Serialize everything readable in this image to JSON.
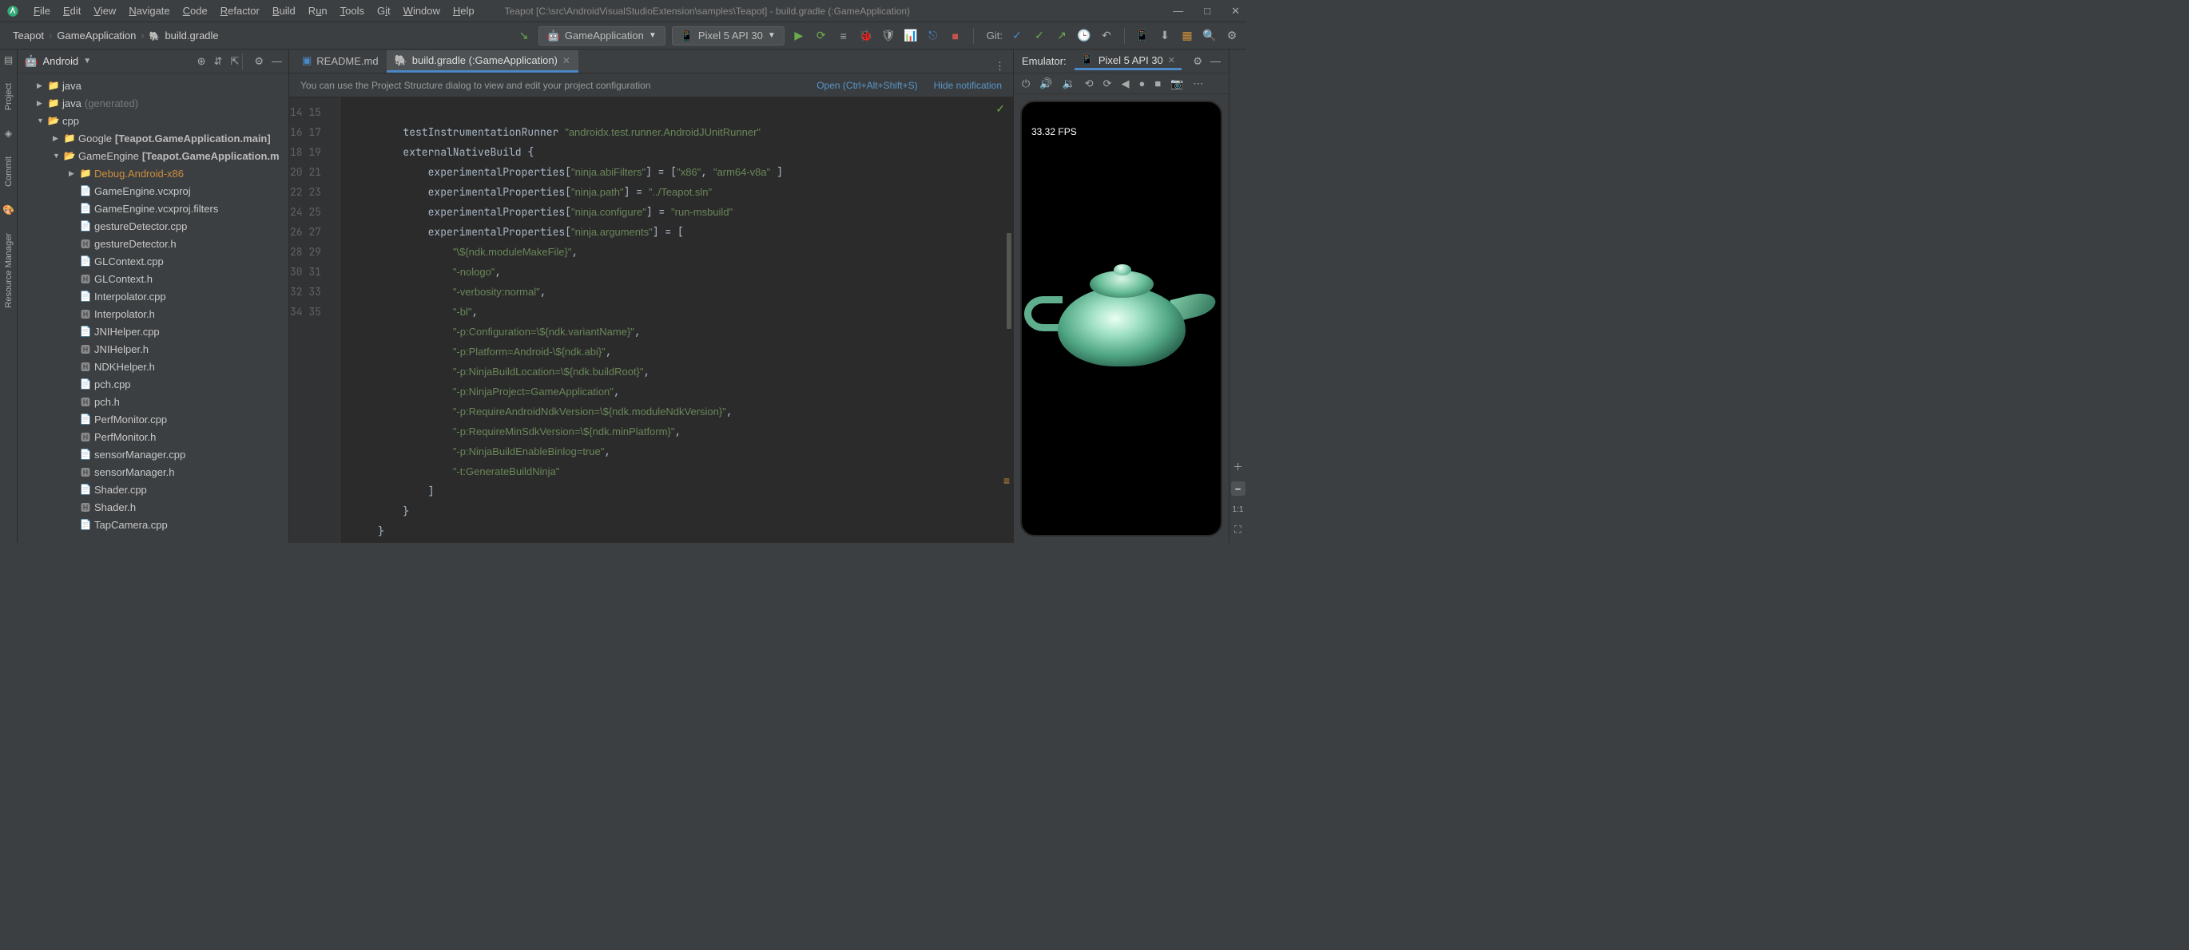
{
  "window": {
    "title": "Teapot [C:\\src\\AndroidVisualStudioExtension\\samples\\Teapot] - build.gradle (:GameApplication)"
  },
  "menubar": [
    "File",
    "Edit",
    "View",
    "Navigate",
    "Code",
    "Refactor",
    "Build",
    "Run",
    "Tools",
    "Git",
    "Window",
    "Help"
  ],
  "breadcrumbs": {
    "c1": "Teapot",
    "c2": "GameApplication",
    "c3": "build.gradle"
  },
  "toolbar": {
    "run_config": "GameApplication",
    "device": "Pixel 5 API 30",
    "git_label": "Git:"
  },
  "project": {
    "title": "Android",
    "nodes": {
      "java": "java",
      "java_gen": "java",
      "java_gen_suffix": "(generated)",
      "cpp": "cpp",
      "google": "Google",
      "google_suffix": "[Teapot.GameApplication.main]",
      "gameengine": "GameEngine",
      "gameengine_suffix": "[Teapot.GameApplication.m",
      "debug": "Debug.Android-x86"
    },
    "files": [
      "GameEngine.vcxproj",
      "GameEngine.vcxproj.filters",
      "gestureDetector.cpp",
      "gestureDetector.h",
      "GLContext.cpp",
      "GLContext.h",
      "Interpolator.cpp",
      "Interpolator.h",
      "JNIHelper.cpp",
      "JNIHelper.h",
      "NDKHelper.h",
      "pch.cpp",
      "pch.h",
      "PerfMonitor.cpp",
      "PerfMonitor.h",
      "sensorManager.cpp",
      "sensorManager.h",
      "Shader.cpp",
      "Shader.h",
      "TapCamera.cpp"
    ]
  },
  "editor": {
    "tab1": "README.md",
    "tab2": "build.gradle (:GameApplication)",
    "notif_text": "You can use the Project Structure dialog to view and edit your project configuration",
    "notif_open": "Open (Ctrl+Alt+Shift+S)",
    "notif_hide": "Hide notification",
    "line_start": 14,
    "lines": [
      "",
      "        testInstrumentationRunner \"androidx.test.runner.AndroidJUnitRunner\"",
      "        externalNativeBuild {",
      "            experimentalProperties[\"ninja.abiFilters\"] = [\"x86\", \"arm64-v8a\" ]",
      "            experimentalProperties[\"ninja.path\"] = \"../Teapot.sln\"",
      "            experimentalProperties[\"ninja.configure\"] = \"run-msbuild\"",
      "            experimentalProperties[\"ninja.arguments\"] = [",
      "                \"\\${ndk.moduleMakeFile}\",",
      "                \"-nologo\",",
      "                \"-verbosity:normal\",",
      "                \"-bl\",",
      "                \"-p:Configuration=\\${ndk.variantName}\",",
      "                \"-p:Platform=Android-\\${ndk.abi}\",",
      "                \"-p:NinjaBuildLocation=\\${ndk.buildRoot}\",",
      "                \"-p:NinjaProject=GameApplication\",",
      "                \"-p:RequireAndroidNdkVersion=\\${ndk.moduleNdkVersion}\",",
      "                \"-p:RequireMinSdkVersion=\\${ndk.minPlatform}\",",
      "                \"-p:NinjaBuildEnableBinlog=true\",",
      "                \"-t:GenerateBuildNinja\"",
      "            ]",
      "        }",
      "    }"
    ]
  },
  "emulator": {
    "title": "Emulator:",
    "tab": "Pixel 5 API 30",
    "fps": "33.32 FPS",
    "ratio": "1:1"
  }
}
